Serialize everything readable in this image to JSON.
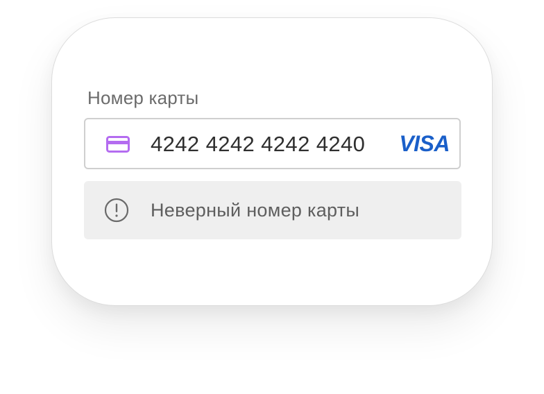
{
  "card_form": {
    "label": "Номер карты",
    "card_number": "4242 4242 4242 4240",
    "card_brand": "VISA",
    "card_brand_color": "#1a5fc9",
    "card_icon": "credit-card-icon",
    "card_icon_color": "#b46cf0",
    "error": {
      "icon": "exclamation-circle-icon",
      "message": "Неверный номер карты"
    }
  }
}
